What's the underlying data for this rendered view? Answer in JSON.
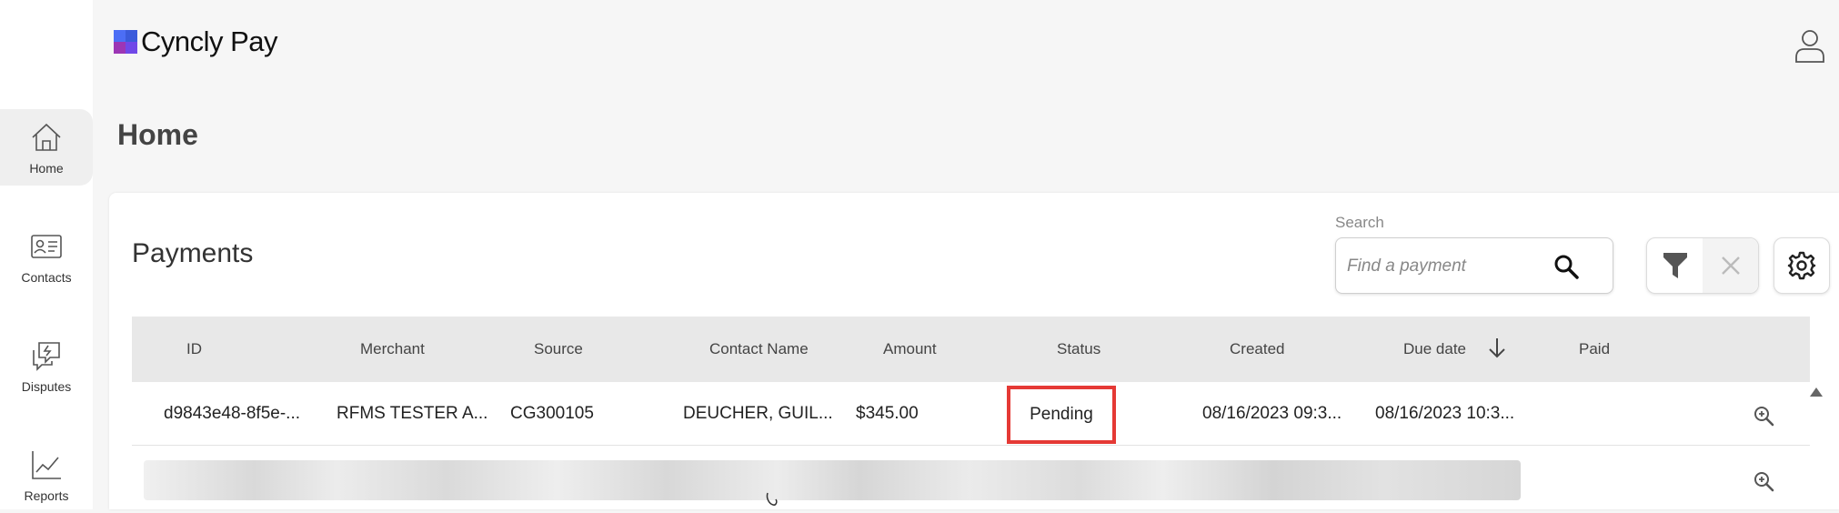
{
  "app": {
    "logo_text": "Cyncly Pay",
    "brand_colors": [
      "#3b5bdb",
      "#9c36b5",
      "#4c6ef5",
      "#7048e8"
    ]
  },
  "sidebar": {
    "items": [
      {
        "label": "Home",
        "icon": "home-icon",
        "active": true
      },
      {
        "label": "Contacts",
        "icon": "contact-card-icon",
        "active": false
      },
      {
        "label": "Disputes",
        "icon": "disputes-icon",
        "active": false
      },
      {
        "label": "Reports",
        "icon": "chart-line-icon",
        "active": false
      }
    ]
  },
  "header": {
    "user_icon": "user-icon"
  },
  "page": {
    "title": "Home"
  },
  "payments": {
    "title": "Payments",
    "search": {
      "label": "Search",
      "placeholder": "Find a payment",
      "value": ""
    },
    "columns": [
      "ID",
      "Merchant",
      "Source",
      "Contact Name",
      "Amount",
      "Status",
      "Created",
      "Due date",
      "Paid"
    ],
    "sorted_by": "Created",
    "rows": [
      {
        "id": "d9843e48-8f5e-...",
        "merchant": "RFMS TESTER A...",
        "source": "CG300105",
        "contact_name": "DEUCHER, GUIL...",
        "amount": "$345.00",
        "status": "Pending",
        "created": "08/16/2023 09:3...",
        "due_date": "08/16/2023 10:3...",
        "paid": ""
      }
    ],
    "status_highlight_color": "#e53935"
  }
}
